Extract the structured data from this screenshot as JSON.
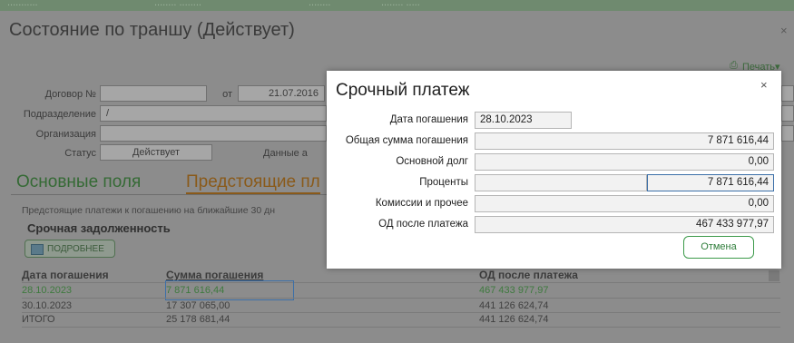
{
  "background": {
    "top_strip": [
      "...........",
      "........ ........",
      "........",
      "........ ....."
    ],
    "title": "Состояние по траншу (Действует)",
    "close": "×",
    "print": "Печать",
    "print_caret": "▾",
    "form": {
      "contract_label": "Договор №",
      "contract_value": "",
      "date_from_label": "от",
      "date_from_value": "21.07.2016",
      "division_label": "Подразделение",
      "division_value": "/",
      "org_label": "Организация",
      "org_value": "",
      "status_label": "Статус",
      "status_value": "Действует",
      "data_label": "Данные а"
    },
    "tabs": [
      "Основные поля",
      "Предстоящие пл"
    ],
    "note": "Предстоящие платежи к погашению на ближайшие 30 дн",
    "section_title": "Срочная задолженность",
    "more_button": "ПОДРОБНЕЕ",
    "table": {
      "headers": [
        "Дата погашения",
        "Сумма погашения",
        "ОД после платежа"
      ],
      "rows": [
        [
          "28.10.2023",
          "7 871 616,44",
          "467 433 977,97"
        ],
        [
          "30.10.2023",
          "17 307 065,00",
          "441 126 624,74"
        ],
        [
          "ИТОГО",
          "25 178 681,44",
          "441 126 624,74"
        ]
      ]
    }
  },
  "dialog": {
    "title": "Срочный платеж",
    "close": "×",
    "fields": [
      {
        "label": "Дата погашения",
        "value": "28.10.2023"
      },
      {
        "label": "Общая сумма погашения",
        "value": "7 871 616,44"
      },
      {
        "label": "Основной долг",
        "value": "0,00"
      },
      {
        "label": "Проценты",
        "value": "7 871 616,44"
      },
      {
        "label": "Комиссии и прочее",
        "value": "0,00"
      },
      {
        "label": "ОД после платежа",
        "value": "467 433 977,97"
      }
    ],
    "cancel": "Отмена"
  },
  "colors": {
    "accent_green": "#2e7d3a",
    "highlight_blue": "#3b6fa8",
    "tab_orange": "#8a5a1a"
  }
}
